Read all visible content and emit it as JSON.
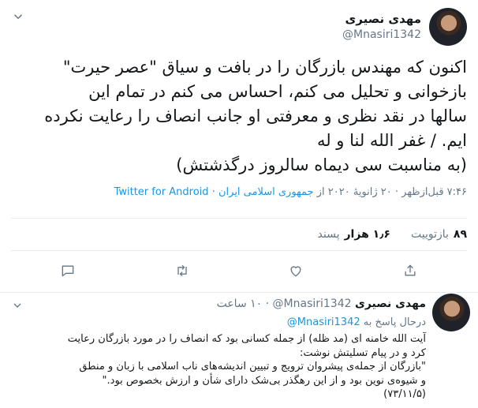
{
  "tweet": {
    "author_name": "مهدی نصیری",
    "author_handle": "@Mnasiri1342",
    "body_lines": [
      "اکنون که مهندس بازرگان را در بافت و سیاق \"عصر حیرت\"",
      "بازخوانی و تحلیل می کنم، احساس می کنم در تمام این",
      "سالها در نقد نظری و معرفتی او جانب انصاف را  رعایت نکرده",
      "ایم. / غفر الله لنا و له",
      "(به مناسبت سی دیماه سالروز درگذشتش)"
    ],
    "meta_time": "۷:۴۶ قبل‌ازظهر · ۲۰ ژانویهٔ ۲۰۲۰ از",
    "meta_location": "جمهوری اسلامی ایران",
    "meta_sep": "·",
    "meta_source": "Twitter for Android",
    "retweets_count": "۸۹",
    "retweets_label": "بازتوییت",
    "likes_count": "۱٫۶ هزار",
    "likes_label": "پسند"
  },
  "reply": {
    "author_name": "مهدی نصیری",
    "author_handle": "@Mnasiri1342",
    "time": "۱۰ ساعت",
    "reply_to_prefix": "درحال پاسخ به",
    "reply_to_handle": "@Mnasiri1342",
    "body_lines": [
      "آیت الله خامنه ای (مد ظله) از جمله کسانی بود که انصاف را در مورد بازرگان رعایت",
      "کرد و در پیام تسلیتش نوشت:",
      "\"بازرگان از جمله‌ی پیشروان ترویج و تبیین اندیشه‌های ناب اسلامی با زبان و منطق",
      "و شیوه‌ی نوین بود و از این رهگذر بی‌شک دارای شأن و ارزش بخصوص بود.\"",
      "(۷۳/۱۱/۵)"
    ]
  },
  "colors": {
    "link": "#1b95e0",
    "muted": "#657786",
    "text": "#14171a"
  },
  "icons": [
    "chevron-down-icon",
    "reply-icon",
    "retweet-icon",
    "like-icon",
    "share-icon"
  ]
}
